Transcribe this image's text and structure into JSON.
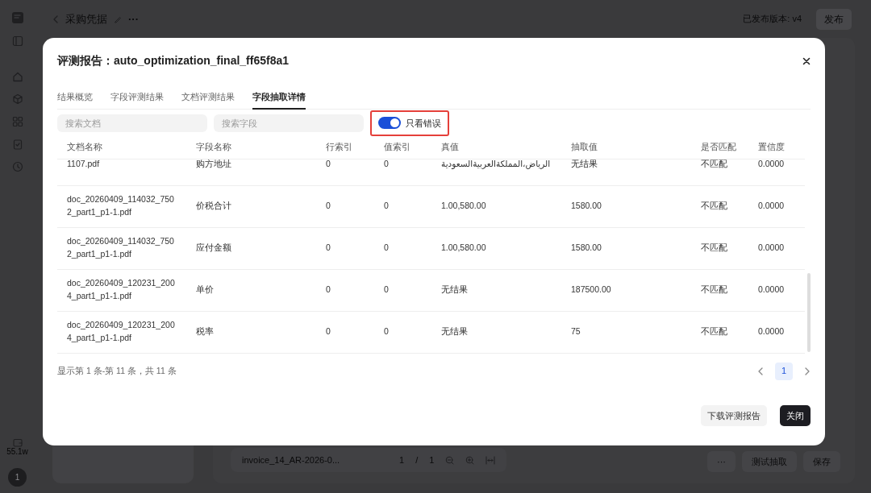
{
  "app": {
    "header": {
      "title": "采购凭据",
      "more": "···",
      "version": "已发布版本: v4",
      "publish": "发布"
    },
    "sidebar": {
      "usage": "55.1w",
      "avatar": "1"
    },
    "viewer": {
      "file": "invoice_14_AR-2026-0...",
      "page": "1",
      "separator": "/",
      "pages": "1"
    },
    "actions": {
      "more": "···",
      "test": "测试抽取",
      "save": "保存"
    }
  },
  "dialog": {
    "title": "评测报告：auto_optimization_final_ff65f8a1",
    "tabs": [
      {
        "label": "结果概览",
        "selected": false
      },
      {
        "label": "字段评测结果",
        "selected": false
      },
      {
        "label": "文档评测结果",
        "selected": false
      },
      {
        "label": "字段抽取详情",
        "selected": true
      }
    ],
    "filters": {
      "doc_search": {
        "placeholder": "搜索文档"
      },
      "field_search": {
        "placeholder": "搜索字段"
      },
      "errors_only": {
        "label": "只看错误",
        "on": true,
        "highlighted": true
      }
    },
    "table": {
      "columns": [
        "文档名称",
        "字段名称",
        "行索引",
        "值索引",
        "真值",
        "抽取值",
        "是否匹配",
        "置信度"
      ],
      "rows": [
        {
          "doc": "1107.pdf",
          "field": "购方地址",
          "row_index": "0",
          "value_index": "0",
          "truth": "الرياض،المملكةالعربيةالسعودية",
          "extracted": "无结果",
          "match": "不匹配",
          "confidence": "0.0000"
        },
        {
          "doc": "doc_20260409_114032_7502_part1_p1-1.pdf",
          "field": "价税合计",
          "row_index": "0",
          "value_index": "0",
          "truth": "1.00,580.00",
          "extracted": "1580.00",
          "match": "不匹配",
          "confidence": "0.0000"
        },
        {
          "doc": "doc_20260409_114032_7502_part1_p1-1.pdf",
          "field": "应付金额",
          "row_index": "0",
          "value_index": "0",
          "truth": "1.00,580.00",
          "extracted": "1580.00",
          "match": "不匹配",
          "confidence": "0.0000"
        },
        {
          "doc": "doc_20260409_120231_2004_part1_p1-1.pdf",
          "field": "单价",
          "row_index": "0",
          "value_index": "0",
          "truth": "无结果",
          "extracted": "187500.00",
          "match": "不匹配",
          "confidence": "0.0000"
        },
        {
          "doc": "doc_20260409_120231_2004_part1_p1-1.pdf",
          "field": "税率",
          "row_index": "0",
          "value_index": "0",
          "truth": "无结果",
          "extracted": "75",
          "match": "不匹配",
          "confidence": "0.0000"
        }
      ]
    },
    "summary": "显示第 1 条-第 11 条，共 11 条",
    "pagination": {
      "pages": [
        {
          "label": "1",
          "selected": true
        }
      ]
    },
    "buttons": [
      {
        "label": "下载评测报告",
        "kind": "secondary"
      },
      {
        "label": "关闭",
        "kind": "primary"
      }
    ]
  }
}
